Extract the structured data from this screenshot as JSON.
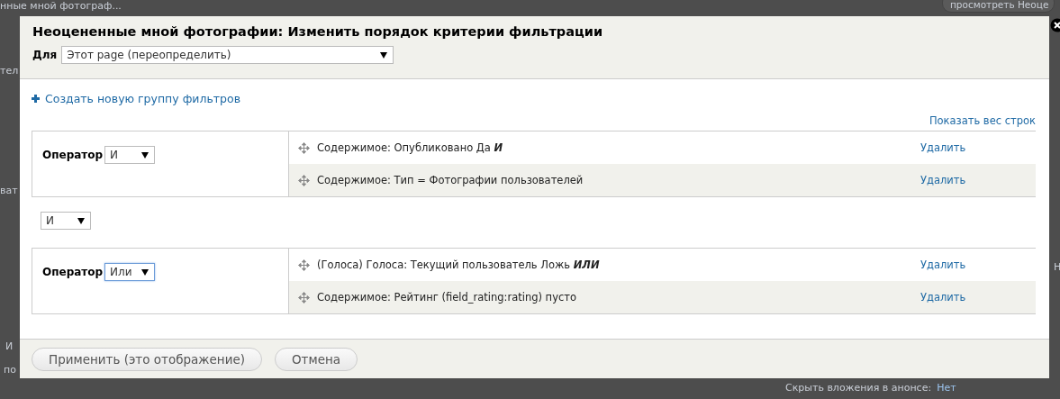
{
  "background": {
    "top_link": "нные мной фотограф...",
    "top_button": "просмотреть Неоце",
    "left_fragments": [
      "тел",
      "ват",
      "И",
      "по"
    ],
    "right_fragment": "Н",
    "bottom_label": "Скрыть вложения в анонсе:",
    "bottom_value": "Нет"
  },
  "dialog": {
    "title": "Неоцененные мной фотографии: Изменить порядок критерии фильтрации",
    "for_label": "Для",
    "for_select": "Этот page (переопределить)",
    "add_group_link": "Создать новую группу фильтров",
    "show_weights_link": "Показать вес строк",
    "groups": [
      {
        "operator_label": "Оператор",
        "operator": "И",
        "focused": false,
        "filters": [
          {
            "text": "Содержимое: Опубликовано Да",
            "conjunction": "И",
            "delete": "Удалить"
          },
          {
            "text": "Содержимое: Тип = Фотографии пользователей",
            "delete": "Удалить"
          }
        ]
      },
      {
        "operator_label": "Оператор",
        "operator": "Или",
        "focused": true,
        "filters": [
          {
            "text": "(Голоса) Голоса: Текущий пользователь Ложь",
            "conjunction": "ИЛИ",
            "delete": "Удалить"
          },
          {
            "text": "Содержимое: Рейтинг (field_rating:rating) пусто",
            "delete": "Удалить"
          }
        ]
      }
    ],
    "between_operator": "И",
    "buttons": [
      "Применить (это отображение)",
      "Отмена"
    ]
  }
}
